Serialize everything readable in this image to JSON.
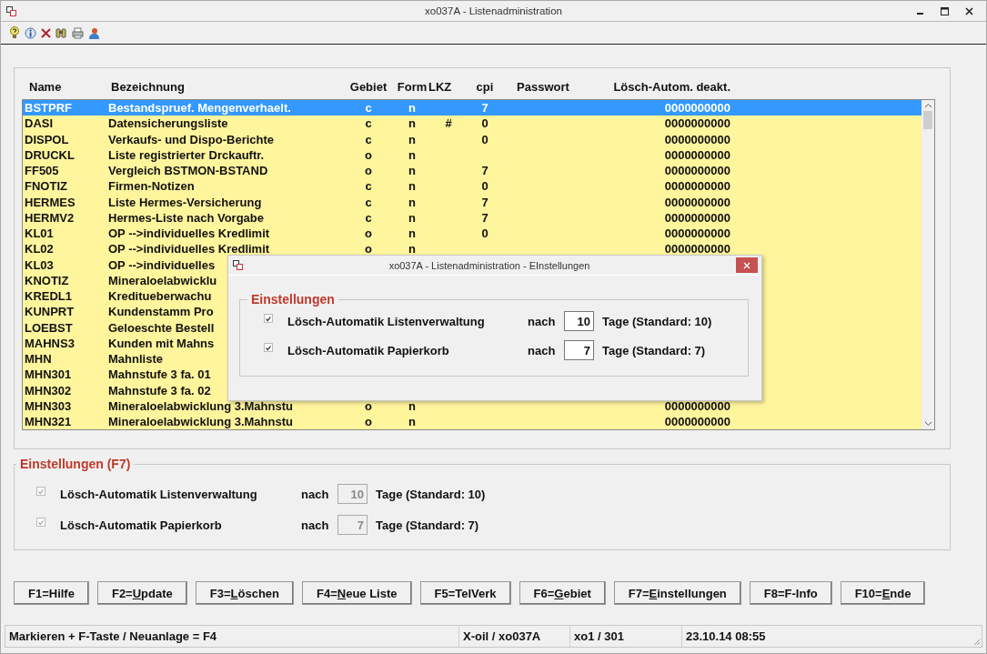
{
  "window": {
    "title": "xo037A - Listenadministration"
  },
  "list": {
    "columns": [
      "Name",
      "Bezeichnung",
      "Gebiet",
      "Form",
      "LKZ",
      "cpi",
      "Passwort",
      "Lösch-Autom. deakt."
    ],
    "rows": [
      {
        "name": "BSTPRF",
        "desc": "Bestandspruef. Mengenverhaelt.",
        "gebiet": "c",
        "form": "n",
        "cpi": "7",
        "auto": "0000000000",
        "selected": true
      },
      {
        "name": "DASI",
        "desc": "Datensicherungsliste",
        "gebiet": "c",
        "form": "n",
        "lkz": "#",
        "cpi": "0",
        "auto": "0000000000",
        "selected": false
      },
      {
        "name": "DISPOL",
        "desc": "Verkaufs- und Dispo-Berichte",
        "gebiet": "c",
        "form": "n",
        "cpi": "0",
        "auto": "0000000000",
        "selected": false
      },
      {
        "name": "DRUCKL",
        "desc": "Liste registrierter Drckauftr.",
        "gebiet": "o",
        "form": "n",
        "auto": "0000000000",
        "selected": false
      },
      {
        "name": "FF505",
        "desc": "Vergleich BSTMON-BSTAND",
        "gebiet": "o",
        "form": "n",
        "cpi": "7",
        "auto": "0000000000",
        "selected": false
      },
      {
        "name": "FNOTIZ",
        "desc": "Firmen-Notizen",
        "gebiet": "c",
        "form": "n",
        "cpi": "0",
        "auto": "0000000000",
        "selected": false
      },
      {
        "name": "HERMES",
        "desc": "Liste Hermes-Versicherung",
        "gebiet": "c",
        "form": "n",
        "cpi": "7",
        "auto": "0000000000",
        "selected": false
      },
      {
        "name": "HERMV2",
        "desc": "Hermes-Liste nach Vorgabe",
        "gebiet": "c",
        "form": "n",
        "cpi": "7",
        "auto": "0000000000",
        "selected": false
      },
      {
        "name": "KL01",
        "desc": "OP -->individuelles Kredlimit",
        "gebiet": "o",
        "form": "n",
        "cpi": "0",
        "auto": "0000000000",
        "selected": false
      },
      {
        "name": "KL02",
        "desc": "OP -->individuelles Kredlimit",
        "gebiet": "o",
        "form": "n",
        "auto": "0000000000",
        "selected": false
      },
      {
        "name": "KL03",
        "desc": "OP -->individuelles",
        "selected": false
      },
      {
        "name": "KNOTIZ",
        "desc": "Mineraloelabwicklu",
        "selected": false
      },
      {
        "name": "KREDL1",
        "desc": "Kreditueberwachu",
        "selected": false
      },
      {
        "name": "KUNPRT",
        "desc": "Kundenstamm Pro",
        "selected": false
      },
      {
        "name": "LOEBST",
        "desc": "Geloeschte Bestell",
        "selected": false
      },
      {
        "name": "MAHNS3",
        "desc": "Kunden mit Mahns",
        "selected": false
      },
      {
        "name": "MHN",
        "desc": "Mahnliste",
        "selected": false
      },
      {
        "name": "MHN301",
        "desc": "Mahnstufe 3 fa. 01",
        "selected": false
      },
      {
        "name": "MHN302",
        "desc": "Mahnstufe 3 fa. 02",
        "selected": false
      },
      {
        "name": "MHN303",
        "desc": "Mineraloelabwicklung 3.Mahnstu",
        "gebiet": "o",
        "form": "n",
        "auto": "0000000000",
        "selected": false
      },
      {
        "name": "MHN321",
        "desc": "Mineraloelabwicklung 3.Mahnstu",
        "gebiet": "o",
        "form": "n",
        "auto": "0000000000",
        "selected": false
      }
    ]
  },
  "settings": {
    "title": "Einstellungen (F7)",
    "disabled": true,
    "items": [
      {
        "label": "Lösch-Automatik Listenverwaltung",
        "checked": true,
        "after": "nach",
        "value": "10",
        "unit": "Tage (Standard: 10)"
      },
      {
        "label": "Lösch-Automatik Papierkorb",
        "checked": true,
        "after": "nach",
        "value": "7",
        "unit": "Tage (Standard: 7)"
      }
    ]
  },
  "buttons": [
    {
      "parts": [
        "F1=Hilfe"
      ]
    },
    {
      "parts": [
        "F2=",
        "U",
        "pdate"
      ]
    },
    {
      "parts": [
        "F3=",
        "L",
        "öschen"
      ]
    },
    {
      "parts": [
        "F4=",
        "N",
        "eue Liste"
      ]
    },
    {
      "parts": [
        "F5=TelVerk"
      ]
    },
    {
      "parts": [
        "F6=",
        "G",
        "ebiet"
      ]
    },
    {
      "parts": [
        "F7=",
        "E",
        "instellungen"
      ]
    },
    {
      "parts": [
        "F8=F-Info"
      ]
    },
    {
      "parts": [
        "F10=",
        "E",
        "nde"
      ]
    }
  ],
  "status_bar": [
    "Markieren + F-Taste / Neuanlage = F4",
    "X-oil / xo037A",
    "xo1 / 301",
    "23.10.14 08:55"
  ],
  "dialog": {
    "title": "xo037A - Listenadministration - EInstellungen",
    "settings": {
      "title": "Einstellungen",
      "disabled": false,
      "items": [
        {
          "label": "Lösch-Automatik Listenverwaltung",
          "checked": true,
          "after": "nach",
          "value": "10",
          "unit": "Tage (Standard: 10)"
        },
        {
          "label": "Lösch-Automatik Papierkorb",
          "checked": true,
          "after": "nach",
          "value": "7",
          "unit": "Tage (Standard: 7)"
        }
      ]
    }
  }
}
